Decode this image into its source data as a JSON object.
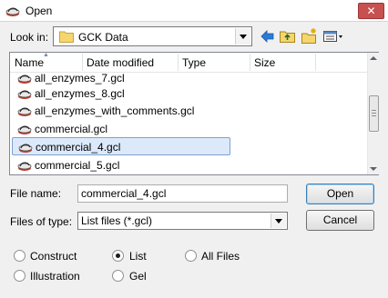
{
  "window": {
    "title": "Open",
    "close_icon": "close-icon"
  },
  "lookin": {
    "label": "Look in:",
    "value": "GCK Data"
  },
  "toolbar": {
    "back_icon": "back-arrow-icon",
    "up_icon": "up-folder-icon",
    "new_folder_icon": "new-folder-icon",
    "view_menu_icon": "view-menu-icon"
  },
  "columns": [
    "Name",
    "Date modified",
    "Type",
    "Size"
  ],
  "files": [
    {
      "name": "all_enzymes_7.gcl"
    },
    {
      "name": "all_enzymes_8.gcl"
    },
    {
      "name": "all_enzymes_with_comments.gcl"
    },
    {
      "name": "commercial.gcl"
    },
    {
      "name": "commercial_4.gcl",
      "selected": true
    },
    {
      "name": "commercial_5.gcl"
    }
  ],
  "filename": {
    "label": "File name:",
    "value": "commercial_4.gcl"
  },
  "filetype": {
    "label": "Files of type:",
    "value": "List files (*.gcl)"
  },
  "buttons": {
    "open": "Open",
    "cancel": "Cancel"
  },
  "radios": [
    {
      "label": "Construct",
      "checked": false
    },
    {
      "label": "List",
      "checked": true
    },
    {
      "label": "All Files",
      "checked": false
    },
    {
      "label": "Illustration",
      "checked": false
    },
    {
      "label": "Gel",
      "checked": false
    }
  ],
  "colors": {
    "selection": "#dce9fa",
    "selection_border": "#7da2ce",
    "close": "#c75050"
  }
}
